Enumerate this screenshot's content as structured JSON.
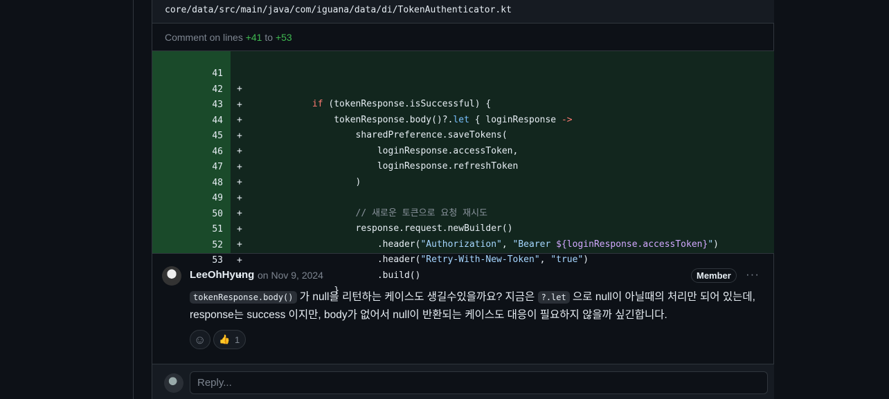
{
  "file": {
    "path": "core/data/src/main/java/com/iguana/data/di/TokenAuthenticator.kt"
  },
  "comment_lines": {
    "prefix": "Comment on lines",
    "from": "+41",
    "to_word": "to",
    "to": "+53"
  },
  "diff": {
    "lines": [
      {
        "num": "41",
        "sign": "+"
      },
      {
        "num": "42",
        "sign": "+"
      },
      {
        "num": "43",
        "sign": "+"
      },
      {
        "num": "44",
        "sign": "+"
      },
      {
        "num": "45",
        "sign": "+"
      },
      {
        "num": "46",
        "sign": "+"
      },
      {
        "num": "47",
        "sign": "+"
      },
      {
        "num": "48",
        "sign": "+"
      },
      {
        "num": "49",
        "sign": "+"
      },
      {
        "num": "50",
        "sign": "+"
      },
      {
        "num": "51",
        "sign": "+"
      },
      {
        "num": "52",
        "sign": "+"
      },
      {
        "num": "53",
        "sign": "+"
      }
    ],
    "code": {
      "l41_kw": "if",
      "l41_rest": " (tokenResponse.isSuccessful) {",
      "l42_a": "tokenResponse.body()?.",
      "l42_let": "let",
      "l42_b": " { loginResponse ",
      "l42_arrow": "->",
      "l43": "sharedPreference.saveTokens(",
      "l44": "loginResponse.accessToken,",
      "l45": "loginResponse.refreshToken",
      "l46": ")",
      "l48": "// 새로운 토큰으로 요청 재시도",
      "l49": "response.request.newBuilder()",
      "l50_a": ".header(",
      "l50_s1": "\"Authorization\"",
      "l50_c": ", ",
      "l50_s2": "\"Bearer ",
      "l50_tmpl": "${loginResponse.accessToken}",
      "l50_s3": "\"",
      "l50_e": ")",
      "l51_a": ".header(",
      "l51_s1": "\"Retry-With-New-Token\"",
      "l51_c": ", ",
      "l51_s2": "\"true\"",
      "l51_e": ")",
      "l52": ".build()",
      "l53": "}"
    }
  },
  "comment": {
    "author": "LeeOhHyung",
    "date": "on Nov 9, 2024",
    "badge": "Member",
    "more": "···",
    "code1": "tokenResponse.body()",
    "text1": " 가 null을 리턴하는 케이스도 생길수있을까요? 지금은 ",
    "code2": "?.let",
    "text2": " 으로 null이 아닐때의 처리만 되어 있는데, response는 success 이지만, body가 없어서 null이 반환되는 케이스도 대응이 필요하지 않을까 싶긴합니다.",
    "reactions": {
      "emoji": "👍",
      "count": "1"
    }
  },
  "reply": {
    "placeholder": "Reply..."
  },
  "colors": {
    "add_bg": "#12261e",
    "add_gutter": "#1a4a2a",
    "keyword": "#ff7b72",
    "string": "#a5d6ff"
  }
}
